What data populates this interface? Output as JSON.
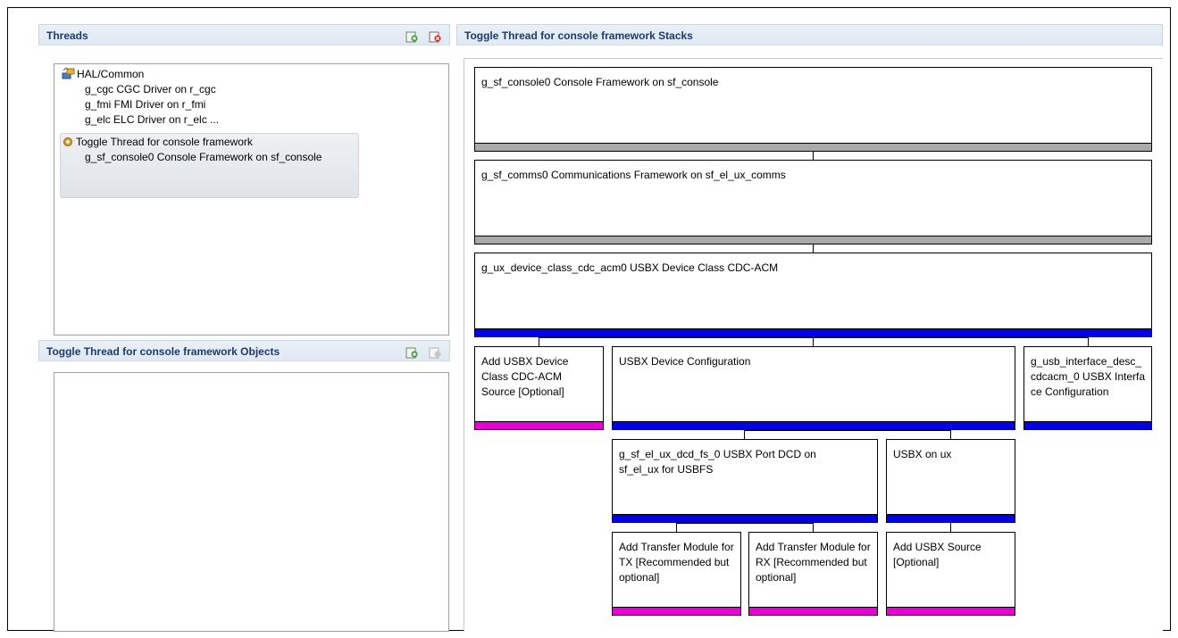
{
  "threads_panel": {
    "title": "Threads",
    "tree": [
      {
        "label": "HAL/Common",
        "icon": "hal-common-icon"
      },
      {
        "label": "g_cgc CGC Driver on r_cgc"
      },
      {
        "label": "g_fmi FMI Driver on r_fmi"
      },
      {
        "label": "g_elc ELC Driver on r_elc ..."
      },
      {
        "label": "Toggle Thread for console framework",
        "icon": "gear-icon"
      },
      {
        "label": "g_sf_console0 Console Framework on sf_console"
      }
    ]
  },
  "objects_panel": {
    "title": "Toggle Thread for console framework Objects"
  },
  "stacks_panel": {
    "title": "Toggle Thread for console framework Stacks",
    "modules": {
      "console": "g_sf_console0 Console Framework on sf_console",
      "comms": "g_sf_comms0 Communications Framework on sf_el_ux_comms",
      "cdc_acm": "g_ux_device_class_cdc_acm0 USBX Device Class CDC-ACM",
      "add_cdc_src": "Add USBX Device Class CDC-ACM Source [Optional]",
      "device_config": "USBX Device Configuration",
      "interface_desc": "g_usb_interface_desc_cdcacm_0 USBX Interface Configuration",
      "port_dcd": "g_sf_el_ux_dcd_fs_0 USBX Port DCD on sf_el_ux for USBFS",
      "usbx_on_ux": "USBX on ux",
      "transfer_tx": "Add Transfer Module for TX [Recommended but optional]",
      "transfer_rx": "Add Transfer Module for RX [Recommended but optional]",
      "add_usbx_src": "Add USBX Source [Optional]"
    }
  },
  "colors": {
    "bar_gray": "#a9a9a9",
    "bar_blue": "#0000e6",
    "bar_pink": "#e600d2",
    "header_title": "#1f3a6a"
  }
}
